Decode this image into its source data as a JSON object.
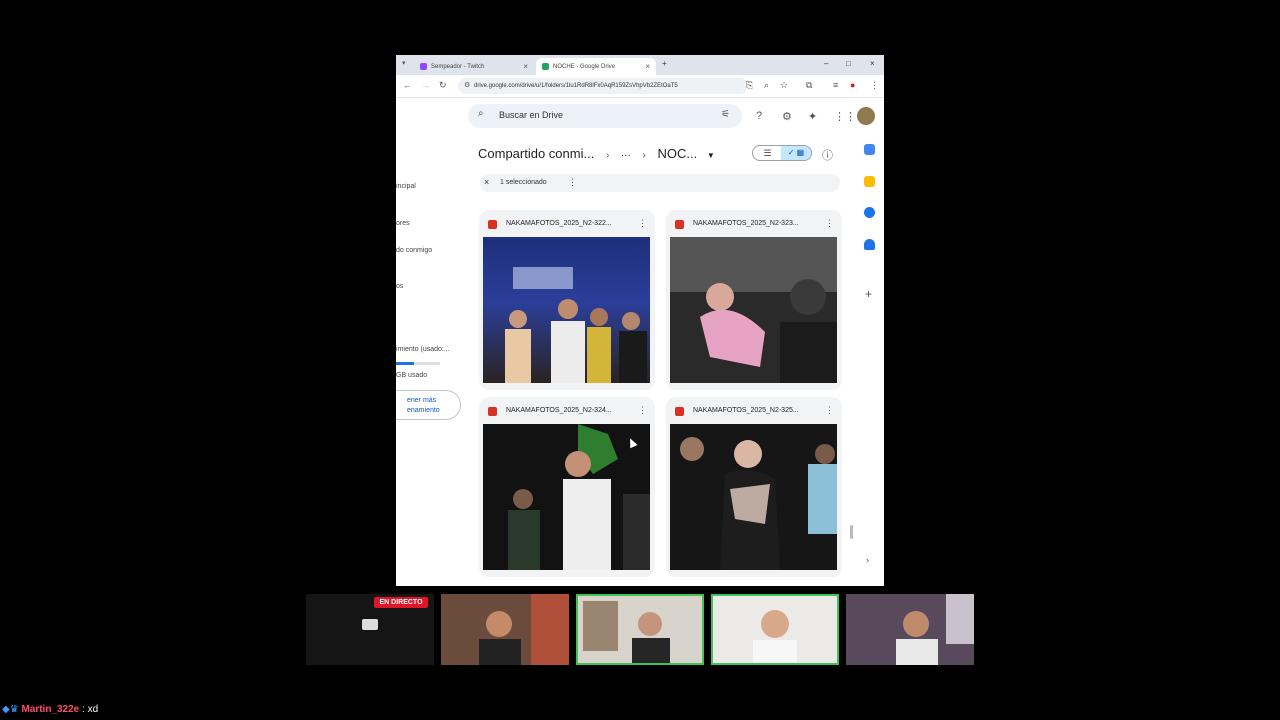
{
  "browser": {
    "tabs": [
      {
        "label": "Sempeador - Twitch",
        "icon": "twitch-icon",
        "color": "#9146ff",
        "active": false
      },
      {
        "label": "NOCHE - Google Drive",
        "icon": "drive-icon",
        "color": "#1fa463",
        "active": true
      }
    ],
    "url": "drive.google.com/drive/u/1/folders/1lu1RdR8lFx0AqR159ZsVhpVb2ZEtOaT5"
  },
  "drive": {
    "search_placeholder": "Buscar en Drive",
    "breadcrumb": {
      "parent": "Compartido conmi...",
      "ellipsis": "···",
      "current": "NOC..."
    },
    "selection": {
      "text": "1 seleccionado"
    },
    "sidebar_fragments": [
      "incipal",
      "ores",
      "do conmigo",
      "os",
      "imiento (usado:...",
      "GB usado"
    ],
    "storage_button": {
      "line1": "ener más",
      "line2": "enamiento"
    },
    "files": [
      {
        "name": "NAKAMAFOTOS_2025_N2-322..."
      },
      {
        "name": "NAKAMAFOTOS_2025_N2-323..."
      },
      {
        "name": "NAKAMAFOTOS_2025_N2-324..."
      },
      {
        "name": "NAKAMAFOTOS_2025_N2-325..."
      }
    ]
  },
  "stream": {
    "live_badge": "EN DIRECTO",
    "chat": {
      "user": "Martin_322e",
      "message": ": xd"
    }
  },
  "colors": {
    "accent": "#0b57d0",
    "selected": "#c2e7ff",
    "live": "#e0152a",
    "speaker": "#3fc25a"
  }
}
